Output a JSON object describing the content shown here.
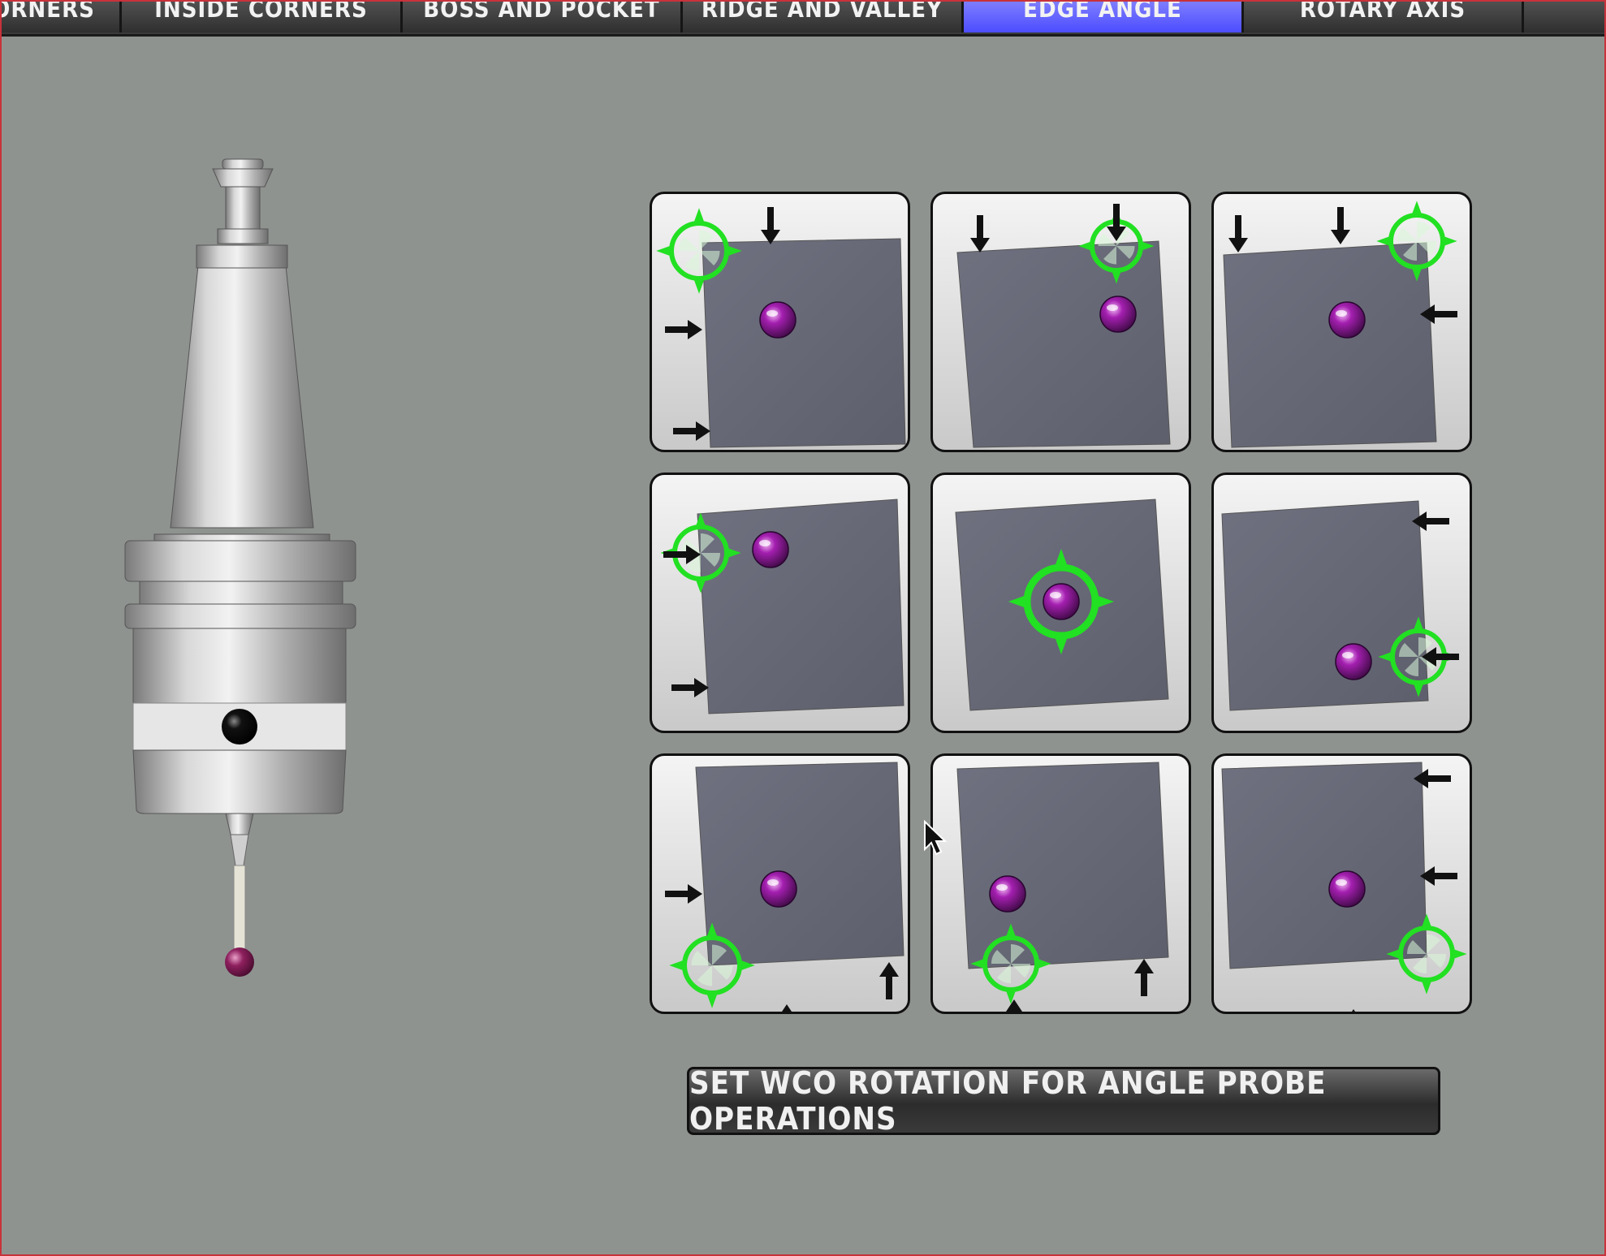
{
  "tabs": [
    {
      "label": "CORNERS",
      "active": false
    },
    {
      "label": "INSIDE CORNERS",
      "active": false
    },
    {
      "label": "BOSS AND POCKET",
      "active": false
    },
    {
      "label": "RIDGE AND VALLEY",
      "active": false
    },
    {
      "label": "EDGE ANGLE",
      "active": true
    },
    {
      "label": "ROTARY AXIS",
      "active": false
    },
    {
      "label": "",
      "active": false
    }
  ],
  "probe_image": {
    "icon": "touch-probe-icon"
  },
  "angle_buttons": [
    {
      "name": "top-left-corner-angle",
      "icons": [
        "arrow-down-icon",
        "arrow-right-icon",
        "green-target-icon"
      ]
    },
    {
      "name": "top-right-corner-angle",
      "icons": [
        "arrow-down-icon",
        "green-target-icon"
      ]
    },
    {
      "name": "top-edge-right-angle",
      "icons": [
        "arrow-down-icon",
        "arrow-left-icon",
        "green-target-icon"
      ]
    },
    {
      "name": "left-edge-angle",
      "icons": [
        "arrow-right-icon",
        "green-target-icon"
      ]
    },
    {
      "name": "center-angle",
      "icons": [
        "green-target-icon"
      ]
    },
    {
      "name": "right-edge-angle",
      "icons": [
        "arrow-left-icon",
        "green-target-icon"
      ]
    },
    {
      "name": "bottom-left-corner-angle",
      "icons": [
        "arrow-up-icon",
        "arrow-right-icon",
        "green-target-icon"
      ]
    },
    {
      "name": "bottom-edge-angle",
      "icons": [
        "arrow-up-icon",
        "green-target-icon"
      ]
    },
    {
      "name": "bottom-right-corner-angle",
      "icons": [
        "arrow-up-icon",
        "arrow-left-icon",
        "green-target-icon"
      ]
    }
  ],
  "set_wco_button": {
    "label": "SET WCO ROTATION FOR ANGLE PROBE OPERATIONS"
  },
  "colors": {
    "background": "#8f9390",
    "tab_bar": "#3a3a3a",
    "active_tab": "#5a5aff",
    "target_green": "#22e022",
    "ball_purple": "#a21caf",
    "plate": "#6b6e7a"
  }
}
